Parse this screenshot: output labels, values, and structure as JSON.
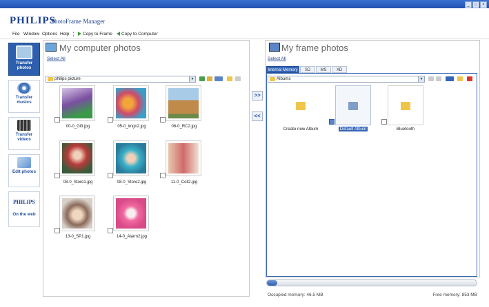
{
  "window": {
    "controls": [
      "_",
      "□",
      "×"
    ]
  },
  "header": {
    "brand": "PHILIPS",
    "product": "PhotoFrame Manager"
  },
  "menu": {
    "items": [
      "File",
      "Window",
      "Options",
      "Help"
    ],
    "copy_to_frame": "Copy to Frame",
    "copy_to_computer": "Copy to Computer"
  },
  "sidebar": {
    "items": [
      {
        "label": "Transfer photos",
        "icon": "monitor-icon",
        "active": true
      },
      {
        "label": "Transfer musics",
        "icon": "music-icon",
        "active": false
      },
      {
        "label": "Transfer videos",
        "icon": "film-icon",
        "active": false
      },
      {
        "label": "Edit photos",
        "icon": "scissors-icon",
        "active": false
      },
      {
        "label": "On the web",
        "brand": "PHILIPS",
        "icon": "philips-logo",
        "active": false
      }
    ]
  },
  "left_panel": {
    "title": "My computer photos",
    "select_all": "Select All",
    "path": "philips picture",
    "photos": [
      {
        "name": "00-0_Gift.jpg"
      },
      {
        "name": "05-0_imgn2.jpg"
      },
      {
        "name": "06-0_RC2.jpg"
      },
      {
        "name": "08-0_Store1.jpg"
      },
      {
        "name": "08-0_Store2.jpg"
      },
      {
        "name": "11-0_Coll2.jpg"
      },
      {
        "name": "13-0_SP1.jpg"
      },
      {
        "name": "14-0_Alarm2.jpg"
      }
    ]
  },
  "transfer": {
    "to_frame": ">>",
    "to_computer": "<<"
  },
  "right_panel": {
    "title": "My frame photos",
    "select_all": "Select All",
    "tabs": [
      "Internal Memory",
      "SD",
      "MS",
      "XD"
    ],
    "active_tab": "Internal Memory",
    "path": "Albums",
    "albums": [
      {
        "name": "Create new Album",
        "selected": false
      },
      {
        "name": "Default Album",
        "selected": true
      },
      {
        "name": "Bluetooth",
        "selected": false
      }
    ]
  },
  "memory": {
    "occupied_label": "Occupied memory: 46.5 MB",
    "free_label": "Free memory: 853 MB",
    "fraction_used": 0.05
  },
  "colors": {
    "brand_blue": "#1a3f8f",
    "accent": "#2d5fae",
    "folder": "#f0c64a"
  }
}
